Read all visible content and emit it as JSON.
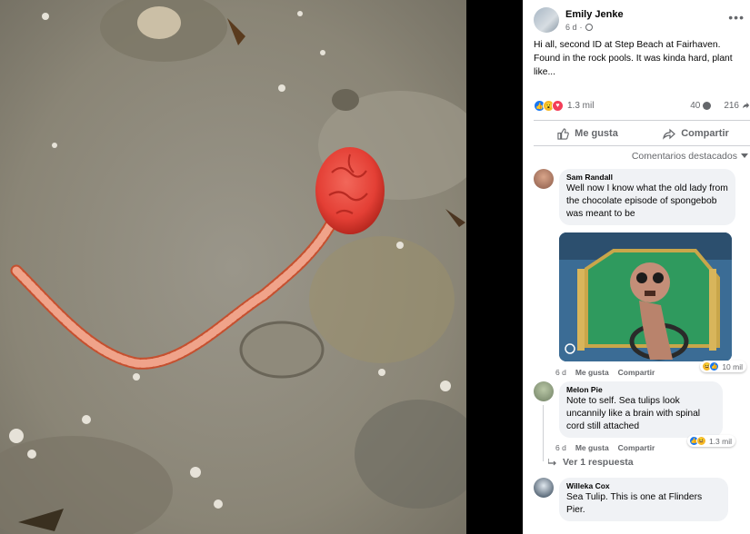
{
  "post": {
    "author": "Emily Jenke",
    "time": "6 d",
    "text": "Hi all, second ID at Step Beach at Fairhaven. Found in the rock pools. It was kinda hard, plant like...",
    "reaction_count": "1.3 mil",
    "comment_count": "40",
    "share_count": "216"
  },
  "actions": {
    "like": "Me gusta",
    "share": "Compartir"
  },
  "comments_sort": "Comentarios destacados",
  "comments": [
    {
      "name": "Sam Randall",
      "text": "Well now I know what the old lady from the chocolate episode of spongebob was meant to be",
      "time": "6 d",
      "like": "Me gusta",
      "share": "Compartir",
      "reactions": "10 mil"
    },
    {
      "name": "Melon Pie",
      "text": "Note to self. Sea tulips look uncannily like a brain with spinal cord still attached",
      "time": "6 d",
      "like": "Me gusta",
      "share": "Compartir",
      "reactions": "1.3 mil",
      "replies": "Ver 1 respuesta"
    },
    {
      "name": "Willeka Cox",
      "text": "Sea Tulip. This is one at Flinders Pier."
    }
  ],
  "icons": [
    "like-icon",
    "wow-icon",
    "love-icon",
    "comment-icon",
    "share-icon",
    "more-icon",
    "globe-icon",
    "chevron-down-icon",
    "reply-arrow-icon"
  ],
  "colors": {
    "accent": "#1877f2",
    "bubble": "#f0f2f5",
    "muted_text": "#65676b",
    "tulip": "#e8453c"
  }
}
